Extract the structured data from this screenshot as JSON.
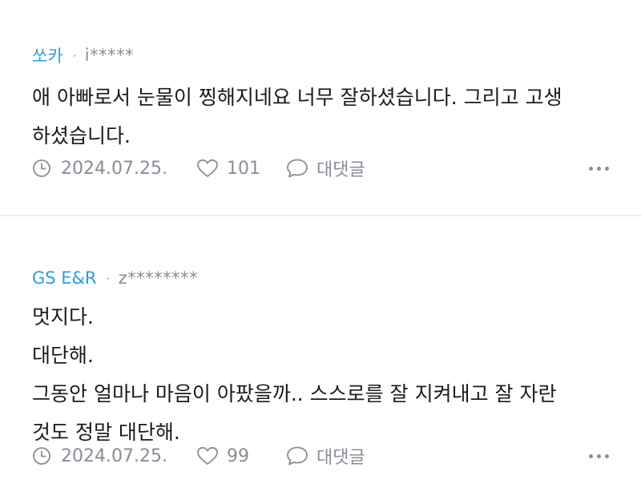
{
  "comments": [
    {
      "author": "쏘카",
      "separator": "·",
      "user_id": "i*****",
      "body_lines": [
        "애 아빠로서 눈물이 찡해지네요 너무 잘하셨습니다. 그리고 고생",
        "하셨습니다."
      ],
      "date": "2024.07.25.",
      "likes": "101",
      "reply_label": "대댓글",
      "icons": {
        "date": "clock-icon",
        "like": "heart-icon",
        "reply": "speech-bubble-icon",
        "more": "more-dots-icon"
      }
    },
    {
      "author": "GS E&R",
      "separator": "·",
      "user_id": "z********",
      "body_lines": [
        "멋지다.",
        "대단해.",
        "그동안 얼마나 마음이 아팠을까.. 스스로를 잘 지켜내고 잘 자란",
        "것도 정말 대단해."
      ],
      "date": "2024.07.25.",
      "likes": "99",
      "reply_label": "대댓글",
      "icons": {
        "date": "clock-icon",
        "like": "heart-icon",
        "reply": "speech-bubble-icon",
        "more": "more-dots-icon"
      }
    }
  ],
  "colors": {
    "author": "#2d9fd6",
    "meta": "#8a8d96",
    "divider": "#ececef",
    "text": "#1b1b1b"
  }
}
